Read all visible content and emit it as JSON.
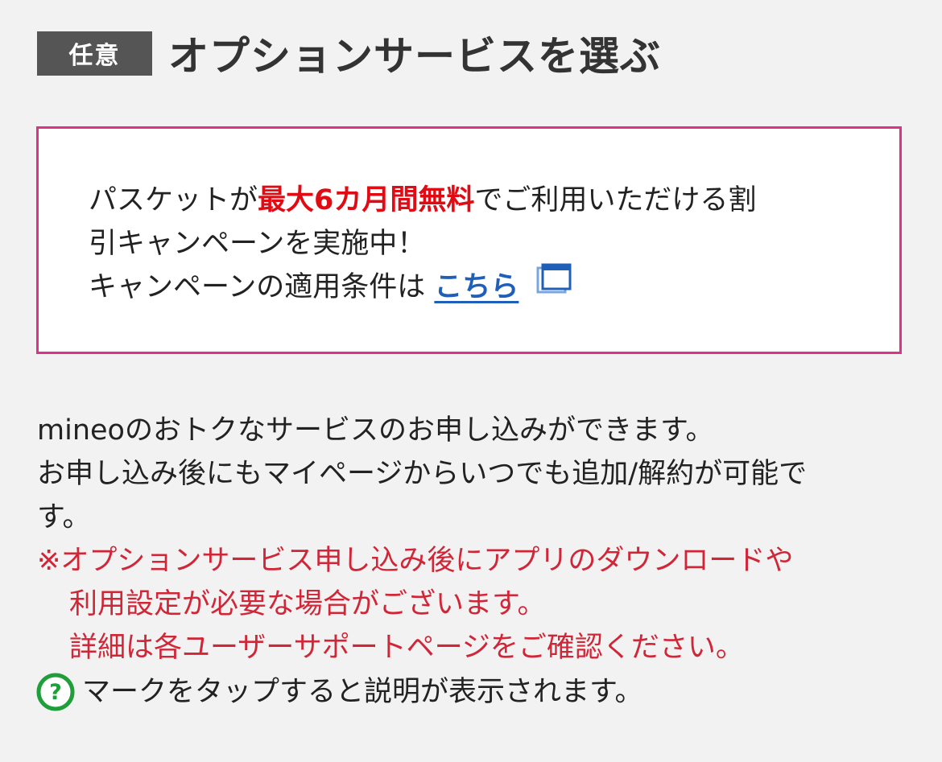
{
  "header": {
    "badge": "任意",
    "title": "オプションサービスを選ぶ"
  },
  "campaign": {
    "text_before": "パスケットが",
    "highlight": "最大6カ月間無料",
    "text_after_1": "でご利用いただける割",
    "line2": "引キャンペーンを実施中！",
    "line3_prefix": "キャンペーンの適用条件は ",
    "link_label": "こちら",
    "link_icon": "external-window-icon",
    "border_color": "#e0318a",
    "highlight_color": "#e10b14",
    "link_color": "#1f5fb8"
  },
  "description": {
    "line1": "mineoのおトクなサービスのお申し込みができます。",
    "line2": "お申し込み後にもマイページからいつでも追加/解約が可能で",
    "line3": "す。"
  },
  "notes": {
    "line1": "※オプションサービス申し込み後にアプリのダウンロードや",
    "line2": "利用設定が必要な場合がございます。",
    "line3": "詳細は各ユーザーサポートページをご確認ください。",
    "color": "#d12637"
  },
  "help": {
    "icon": "question-circle-icon",
    "icon_glyph": "?",
    "text": "マークをタップすると説明が表示されます。",
    "icon_color": "#1f9e3a"
  }
}
